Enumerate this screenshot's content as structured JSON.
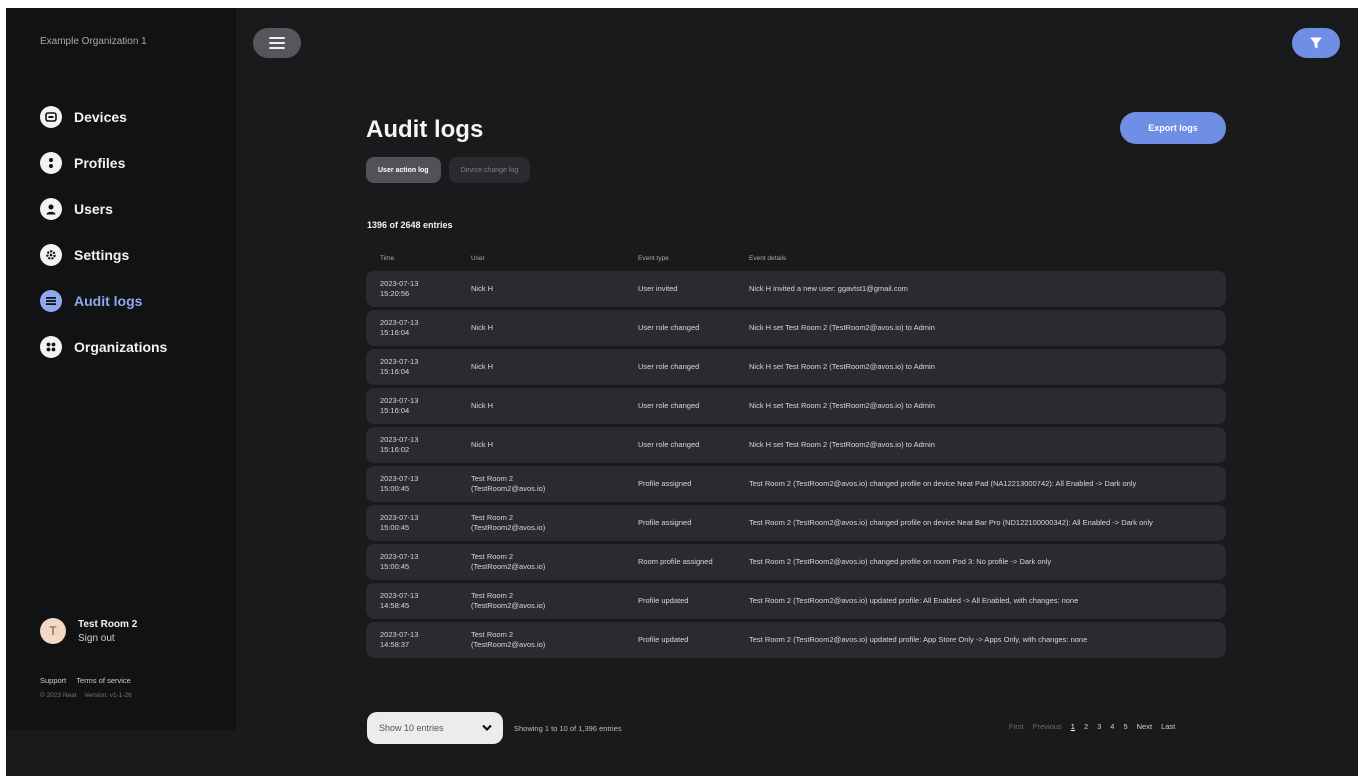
{
  "sidebar": {
    "org_name": "Example Organization 1",
    "items": [
      {
        "label": "Devices",
        "icon": "device-icon"
      },
      {
        "label": "Profiles",
        "icon": "profile-icon"
      },
      {
        "label": "Users",
        "icon": "user-icon"
      },
      {
        "label": "Settings",
        "icon": "gear-icon"
      },
      {
        "label": "Audit logs",
        "icon": "list-icon"
      },
      {
        "label": "Organizations",
        "icon": "grid-icon"
      }
    ],
    "active_item": "Audit logs",
    "account": {
      "avatar_letter": "T",
      "name": "Test Room 2",
      "sign_out": "Sign out"
    },
    "links": {
      "support": "Support",
      "terms": "Terms of service"
    },
    "meta": {
      "copyright": "© 2023 Neat",
      "version": "Version: v1-1-26"
    }
  },
  "header": {
    "menu_icon": "hamburger-icon",
    "filter_icon": "filter-icon"
  },
  "main": {
    "title": "Audit logs",
    "export_label": "Export logs",
    "tabs": [
      {
        "label": "User action log",
        "active": true
      },
      {
        "label": "Device change log",
        "active": false
      }
    ],
    "entries_summary": "1396 of 2648 entries",
    "columns": [
      "Time",
      "User",
      "Event type",
      "Event details"
    ],
    "rows": [
      {
        "time_date": "2023-07-13",
        "time_clock": "15:20:56",
        "user_name": "Nick H",
        "user_email": "",
        "event_type": "User invited",
        "event_details": "Nick H invited a new user: ggavtst1@gmail.com"
      },
      {
        "time_date": "2023-07-13",
        "time_clock": "15:16:04",
        "user_name": "Nick H",
        "user_email": "",
        "event_type": "User role changed",
        "event_details": "Nick H set Test Room 2 (TestRoom2@avos.io) to Admin"
      },
      {
        "time_date": "2023-07-13",
        "time_clock": "15:16:04",
        "user_name": "Nick H",
        "user_email": "",
        "event_type": "User role changed",
        "event_details": "Nick H set Test Room 2 (TestRoom2@avos.io) to Admin"
      },
      {
        "time_date": "2023-07-13",
        "time_clock": "15:16:04",
        "user_name": "Nick H",
        "user_email": "",
        "event_type": "User role changed",
        "event_details": "Nick H set Test Room 2 (TestRoom2@avos.io) to Admin"
      },
      {
        "time_date": "2023-07-13",
        "time_clock": "15:16:02",
        "user_name": "Nick H",
        "user_email": "",
        "event_type": "User role changed",
        "event_details": "Nick H set Test Room 2 (TestRoom2@avos.io) to Admin"
      },
      {
        "time_date": "2023-07-13",
        "time_clock": "15:00:45",
        "user_name": "Test Room 2",
        "user_email": "(TestRoom2@avos.io)",
        "event_type": "Profile assigned",
        "event_details": "Test Room 2 (TestRoom2@avos.io) changed profile on device Neat Pad (NA12213000742): All Enabled -> Dark only"
      },
      {
        "time_date": "2023-07-13",
        "time_clock": "15:00:45",
        "user_name": "Test Room 2",
        "user_email": "(TestRoom2@avos.io)",
        "event_type": "Profile assigned",
        "event_details": "Test Room 2 (TestRoom2@avos.io) changed profile on device Neat Bar Pro (ND122100000342): All Enabled -> Dark only"
      },
      {
        "time_date": "2023-07-13",
        "time_clock": "15:00:45",
        "user_name": "Test Room 2",
        "user_email": "(TestRoom2@avos.io)",
        "event_type": "Room profile assigned",
        "event_details": "Test Room 2 (TestRoom2@avos.io) changed profile on room Pod 3: No profile -> Dark only"
      },
      {
        "time_date": "2023-07-13",
        "time_clock": "14:58:45",
        "user_name": "Test Room 2",
        "user_email": "(TestRoom2@avos.io)",
        "event_type": "Profile updated",
        "event_details": "Test Room 2 (TestRoom2@avos.io) updated profile: All Enabled -> All Enabled, with changes: none"
      },
      {
        "time_date": "2023-07-13",
        "time_clock": "14:58:37",
        "user_name": "Test Room 2",
        "user_email": "(TestRoom2@avos.io)",
        "event_type": "Profile updated",
        "event_details": "Test Room 2 (TestRoom2@avos.io) updated profile: App Store Only -> Apps Only, with changes: none"
      }
    ]
  },
  "footer": {
    "page_size_label": "Show 10 entries",
    "showing_text": "Showing 1 to 10 of 1,396 entries",
    "pagination": {
      "first": "First",
      "previous": "Previous",
      "pages": [
        "1",
        "2",
        "3",
        "4",
        "5"
      ],
      "current": "1",
      "next": "Next",
      "last": "Last"
    }
  },
  "colors": {
    "accent": "#6f8ee6",
    "active_nav": "#8fa8f0",
    "background": "#191a1c",
    "sidebar": "#111214",
    "row": "#2a2b2e"
  }
}
